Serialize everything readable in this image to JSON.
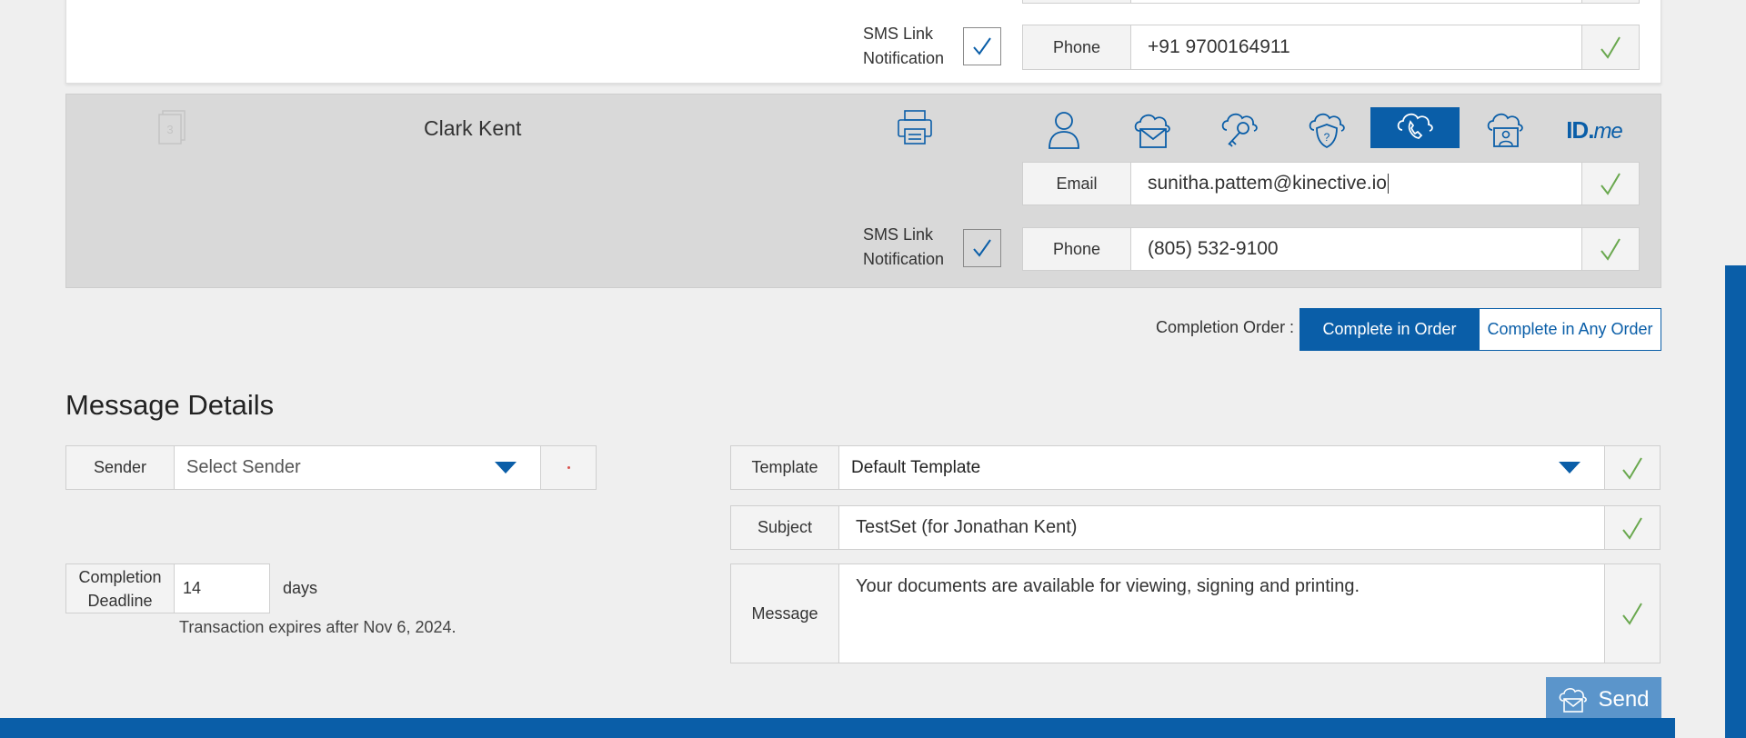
{
  "signers": [
    {
      "sms_label_line1": "SMS Link",
      "sms_label_line2": "Notification",
      "phone_label": "Phone",
      "phone_value": "+91 9700164911"
    },
    {
      "order_badge": "3",
      "name": "Clark Kent",
      "email_label": "Email",
      "email_value": "sunitha.pattem@kinective.io",
      "sms_label_line1": "SMS Link",
      "sms_label_line2": "Notification",
      "phone_label": "Phone",
      "phone_value": "(805) 532-9100",
      "auth_icons": [
        "user-icon",
        "cloud-mail-icon",
        "cloud-key-icon",
        "shield-question-icon",
        "phone-icon",
        "cloud-person-icon",
        "idme-logo"
      ],
      "idme_text_id": "ID.",
      "idme_text_me": "me"
    }
  ],
  "completion_order": {
    "label": "Completion Order :",
    "in_order": "Complete in Order",
    "any_order": "Complete in Any Order"
  },
  "message_details": {
    "title": "Message Details",
    "sender_label": "Sender",
    "sender_placeholder": "Select Sender",
    "template_label": "Template",
    "template_value": "Default Template",
    "subject_label": "Subject",
    "subject_value": "TestSet (for Jonathan Kent)",
    "message_label": "Message",
    "message_value": "Your documents are available for viewing, signing and printing.",
    "deadline_label_line1": "Completion",
    "deadline_label_line2": "Deadline",
    "deadline_value": "14",
    "deadline_unit": "days",
    "expiry_text": "Transaction expires after Nov 6, 2024."
  },
  "send_label": "Send",
  "colors": {
    "accent": "#0a5ea8",
    "check": "#6aa84f",
    "send": "#5b95cb"
  }
}
